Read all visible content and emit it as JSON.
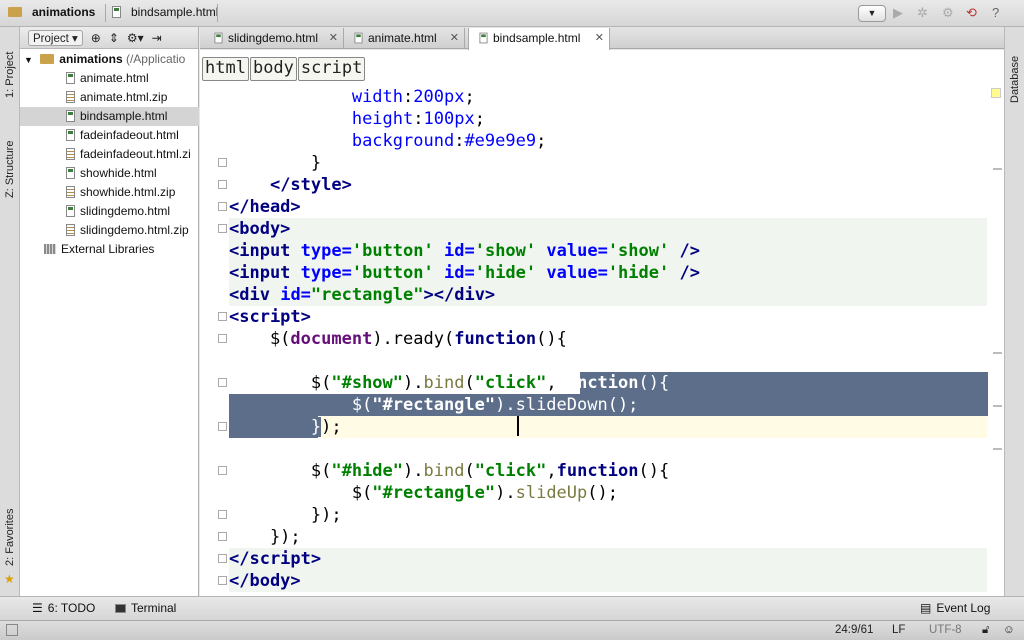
{
  "breadcrumb": {
    "project": "animations",
    "file": "bindsample.html"
  },
  "left_tabs": {
    "project": "1: Project",
    "structure": "Z: Structure",
    "favorites": "2: Favorites"
  },
  "right_tabs": {
    "database": "Database"
  },
  "project_panel": {
    "dropdown": "Project",
    "root": "animations",
    "root_path": " (/Applicatio",
    "files": [
      {
        "name": "animate.html",
        "type": "html",
        "selected": false
      },
      {
        "name": "animate.html.zip",
        "type": "zip",
        "selected": false
      },
      {
        "name": "bindsample.html",
        "type": "html",
        "selected": true
      },
      {
        "name": "fadeinfadeout.html",
        "type": "html",
        "selected": false
      },
      {
        "name": "fadeinfadeout.html.zi",
        "type": "zip",
        "selected": false
      },
      {
        "name": "showhide.html",
        "type": "html",
        "selected": false
      },
      {
        "name": "showhide.html.zip",
        "type": "zip",
        "selected": false
      },
      {
        "name": "slidingdemo.html",
        "type": "html",
        "selected": false
      },
      {
        "name": "slidingdemo.html.zip",
        "type": "zip",
        "selected": false
      }
    ],
    "external": "External Libraries"
  },
  "tabs": [
    {
      "label": "slidingdemo.html"
    },
    {
      "label": "animate.html"
    },
    {
      "label": "bindsample.html",
      "active": true
    }
  ],
  "editor_breadcrumbs": [
    "html",
    "body",
    "script"
  ],
  "code": {
    "l1": "width",
    "l1v": "200",
    "l2": "height",
    "l2v": "100",
    "l3": "background",
    "l3v": "#e9e9e9"
  },
  "status": {
    "todo": "6: TODO",
    "terminal": "Terminal",
    "event_log": "Event Log"
  },
  "bottom": {
    "position": "24:9/61",
    "line_sep": "LF",
    "encoding": "UTF-8"
  },
  "colors": {
    "selection": "#5d6e8a",
    "tag": "#000080",
    "string": "#008000",
    "attr": "#0000ff"
  }
}
